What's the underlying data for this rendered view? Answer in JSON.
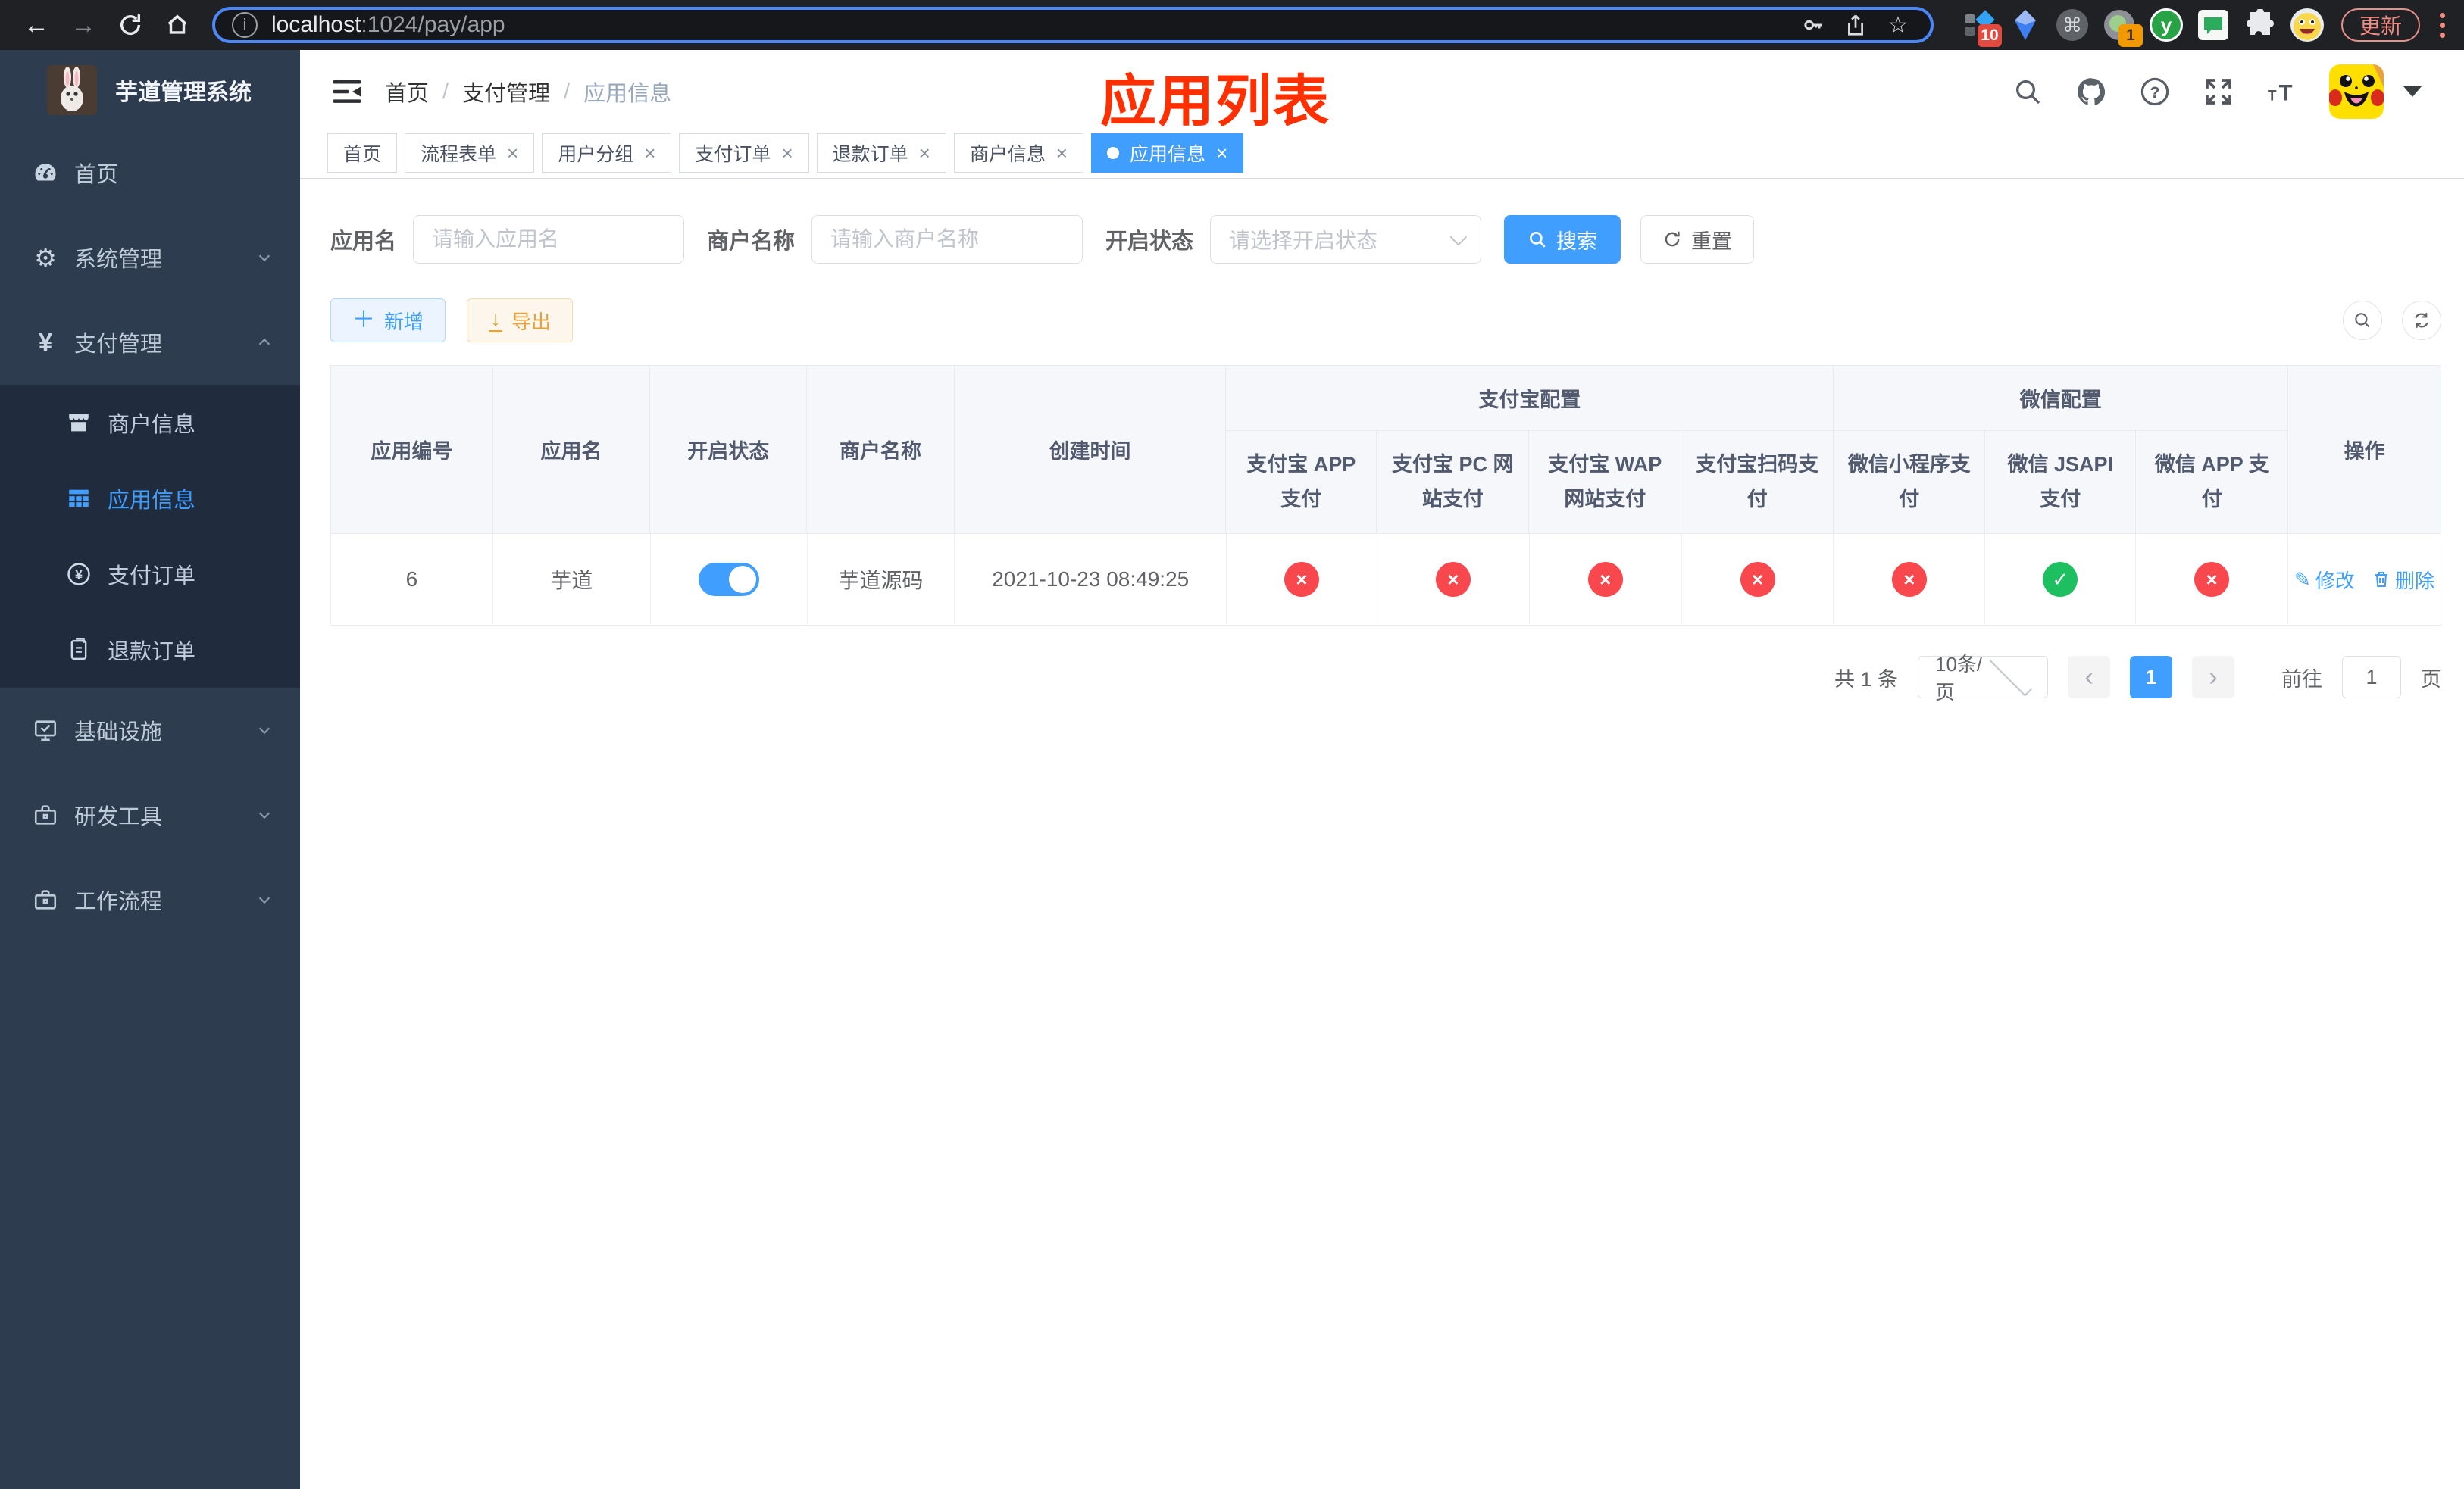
{
  "colors": {
    "accent": "#409eff",
    "danger": "#f8484e",
    "success": "#1dbf60",
    "warning": "#e6a23c",
    "annotation_red": "#ff2f00"
  },
  "browser": {
    "url_host": "localhost",
    "url_rest": ":1024/pay/app",
    "update_label": "更新",
    "ext_badge_pieces": "10",
    "ext_badge_record": "1",
    "ext_letter": "y"
  },
  "sidebar": {
    "title": "芋道管理系统",
    "items": [
      {
        "label": "首页"
      },
      {
        "label": "系统管理"
      },
      {
        "label": "支付管理"
      },
      {
        "label": "商户信息"
      },
      {
        "label": "应用信息"
      },
      {
        "label": "支付订单"
      },
      {
        "label": "退款订单"
      },
      {
        "label": "基础设施"
      },
      {
        "label": "研发工具"
      },
      {
        "label": "工作流程"
      }
    ]
  },
  "breadcrumb": {
    "items": [
      "首页",
      "支付管理",
      "应用信息"
    ],
    "sep": "/"
  },
  "annotation": "应用列表",
  "tabs": [
    {
      "label": "首页"
    },
    {
      "label": "流程表单",
      "close": "×"
    },
    {
      "label": "用户分组",
      "close": "×"
    },
    {
      "label": "支付订单",
      "close": "×"
    },
    {
      "label": "退款订单",
      "close": "×"
    },
    {
      "label": "商户信息",
      "close": "×"
    },
    {
      "label": "应用信息",
      "close": "×"
    }
  ],
  "filters": {
    "app_name_label": "应用名",
    "app_name_placeholder": "请输入应用名",
    "merchant_label": "商户名称",
    "merchant_placeholder": "请输入商户名称",
    "status_label": "开启状态",
    "status_placeholder": "请选择开启状态",
    "search_label": "搜索",
    "reset_label": "重置"
  },
  "toolbar": {
    "add_label": "新增",
    "export_label": "导出"
  },
  "table": {
    "groups": {
      "alipay": "支付宝配置",
      "wechat": "微信配置"
    },
    "columns": {
      "id": "应用编号",
      "name": "应用名",
      "status": "开启状态",
      "merchant": "商户名称",
      "created": "创建时间",
      "alipay_app": "支付宝 APP 支付",
      "alipay_pc": "支付宝 PC 网站支付",
      "alipay_wap": "支付宝 WAP 网站支付",
      "alipay_qr": "支付宝扫码支付",
      "wx_lite": "微信小程序支付",
      "wx_jsapi": "微信 JSAPI 支付",
      "wx_app": "微信 APP 支付",
      "ops": "操作"
    },
    "row": {
      "id": "6",
      "name": "芋道",
      "enabled": true,
      "merchant": "芋道源码",
      "created": "2021-10-23 08:49:25",
      "flags": [
        false,
        false,
        false,
        false,
        false,
        true,
        false
      ],
      "edit_label": "修改",
      "delete_label": "删除"
    }
  },
  "pagination": {
    "total": "共 1 条",
    "page_size": "10条/页",
    "prev": "‹",
    "next": "›",
    "page": "1",
    "goto_label": "前往",
    "goto_value": "1",
    "page_unit": "页"
  }
}
